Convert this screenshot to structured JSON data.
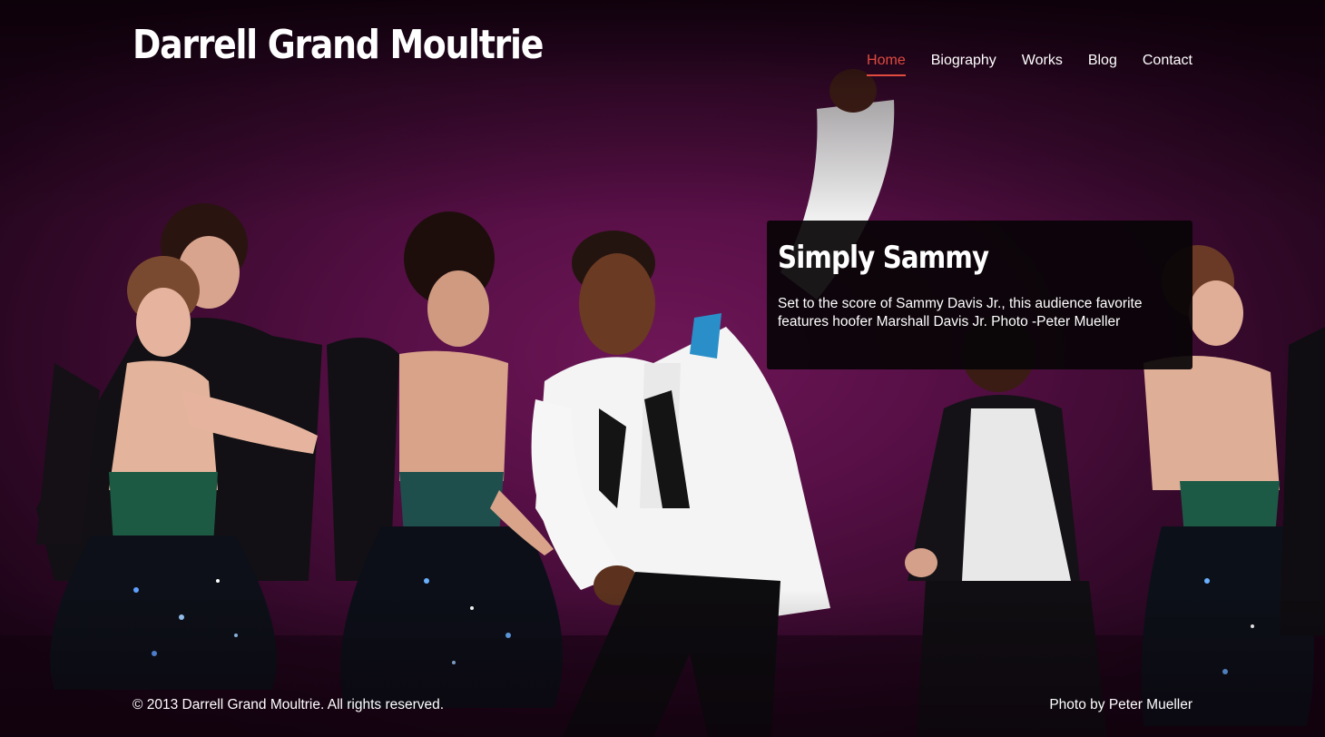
{
  "site": {
    "title": "Darrell Grand Moultrie"
  },
  "nav": {
    "items": [
      {
        "label": "Home",
        "active": true
      },
      {
        "label": "Biography",
        "active": false
      },
      {
        "label": "Works",
        "active": false
      },
      {
        "label": "Blog",
        "active": false
      },
      {
        "label": "Contact",
        "active": false
      }
    ]
  },
  "slide": {
    "heading": "Simply Sammy",
    "description": "Set to the score of Sammy Davis Jr., this audience favorite features hoofer Marshall Davis Jr. Photo -Peter Mueller"
  },
  "footer": {
    "copyright": "© 2013 Darrell Grand Moultrie. All rights reserved.",
    "photo_credit": "Photo by Peter Mueller"
  },
  "colors": {
    "accent": "#e04a3f",
    "background": "#5a0f47",
    "caption_bg": "#080406",
    "text": "#ffffff"
  }
}
